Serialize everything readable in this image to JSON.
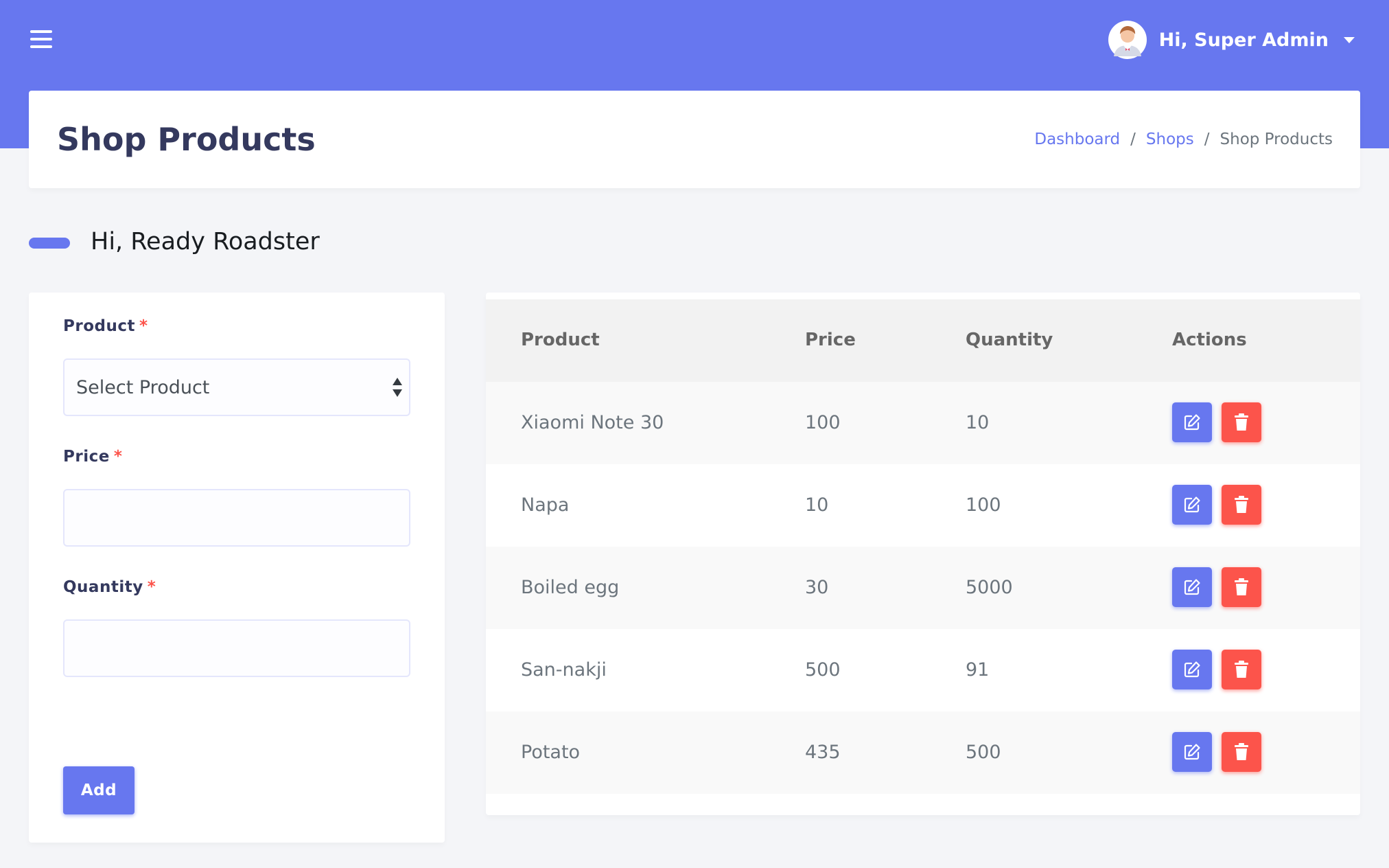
{
  "topbar": {
    "user_name": "Hi, Super Admin"
  },
  "header": {
    "title": "Shop Products",
    "breadcrumb": [
      {
        "label": "Dashboard"
      },
      {
        "label": "Shops"
      },
      {
        "label": "Shop Products"
      }
    ],
    "separator": "/"
  },
  "greeting": "Hi, Ready Roadster",
  "form": {
    "product_label": "Product",
    "product_placeholder": "Select Product",
    "price_label": "Price",
    "price_value": "",
    "quantity_label": "Quantity",
    "quantity_value": "",
    "required_mark": "*",
    "add_label": "Add"
  },
  "table": {
    "columns": [
      "Product",
      "Price",
      "Quantity",
      "Actions"
    ],
    "rows": [
      {
        "product": "Xiaomi Note 30",
        "price": "100",
        "quantity": "10"
      },
      {
        "product": "Napa",
        "price": "10",
        "quantity": "100"
      },
      {
        "product": "Boiled egg",
        "price": "30",
        "quantity": "5000"
      },
      {
        "product": "San-nakji",
        "price": "500",
        "quantity": "91"
      },
      {
        "product": "Potato",
        "price": "435",
        "quantity": "500"
      }
    ]
  },
  "icons": {
    "menu": "hamburger-icon",
    "user": "avatar",
    "dropdown": "caret-down-icon",
    "select": "select-arrows-icon",
    "edit": "edit-icon",
    "delete": "trash-icon"
  },
  "colors": {
    "primary": "#6777ef",
    "danger": "#fc544b",
    "background": "#f4f5f8"
  }
}
